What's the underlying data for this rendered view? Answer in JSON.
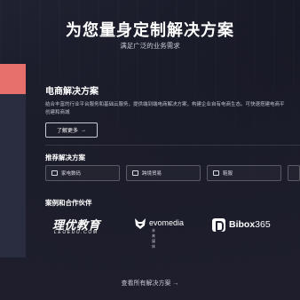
{
  "hero": {
    "title": "为您量身定制解决方案",
    "subtitle": "满足广泛的业务需求"
  },
  "solution": {
    "title": "电商解决方案",
    "description_lines": [
      "结合丰富的行业平台服务和基础云服务，提供端到端电商解决方案，构建企业自有电商生态。可快速搭建电商平",
      "创建和商城"
    ],
    "more_label": "了解更多",
    "more_arrow": "→"
  },
  "recommended": {
    "title": "推荐解决方案",
    "items": [
      {
        "label": "家电数码",
        "icon": "box-icon"
      },
      {
        "label": "跨境贸易",
        "icon": "box-icon"
      },
      {
        "label": "鞋服",
        "icon": "box-icon"
      }
    ]
  },
  "partners": {
    "title": "案例和合作伙伴",
    "logos": [
      {
        "name": "理优教育",
        "subtitle": "LEOEDU.COM"
      },
      {
        "name": "evomedia",
        "subtitle": "未 来 媒 体"
      },
      {
        "name": "Bibox",
        "suffix": "365"
      }
    ]
  },
  "footer": {
    "link_label": "查看所有解决方案",
    "arrow": "→"
  },
  "colors": {
    "accent": "#e8706b",
    "background": "#1f2030",
    "text_secondary": "#bfc2cf"
  }
}
